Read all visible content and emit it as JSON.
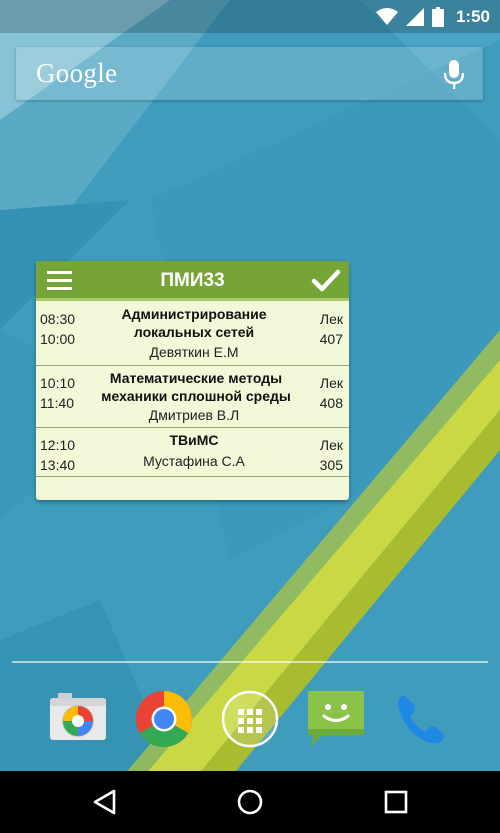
{
  "status_bar": {
    "time": "1:50",
    "icons": [
      "wifi-icon",
      "signal-icon",
      "battery-icon"
    ]
  },
  "search": {
    "logo": "Google",
    "mic_icon": "mic-icon"
  },
  "widget": {
    "title": "ПМИ33",
    "menu_icon": "menu-icon",
    "done_icon": "check-icon",
    "accent_color": "#76a537",
    "background_color": "#f2f8d8",
    "lessons": [
      {
        "start": "08:30",
        "end": "10:00",
        "subject": "Администрирование локальных сетей",
        "teacher": "Девяткин Е.М",
        "type": "Лек",
        "room": "407"
      },
      {
        "start": "10:10",
        "end": "11:40",
        "subject": "Математические методы механики сплошной среды",
        "teacher": "Дмитриев В.Л",
        "type": "Лек",
        "room": "408"
      },
      {
        "start": "12:10",
        "end": "13:40",
        "subject": "ТВиМС",
        "teacher": "Мустафина С.А",
        "type": "Лек",
        "room": "305"
      }
    ]
  },
  "dock": {
    "apps": [
      "camera-icon",
      "chrome-icon",
      "app-drawer-icon",
      "messenger-icon",
      "phone-icon"
    ]
  },
  "navigation": {
    "buttons": [
      "back-icon",
      "home-icon",
      "recents-icon"
    ]
  }
}
